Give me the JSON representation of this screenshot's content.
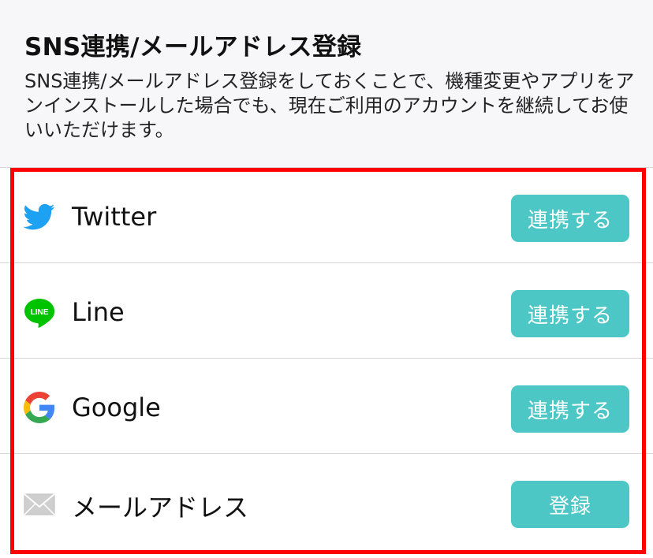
{
  "header": {
    "title": "SNS連携/メールアドレス登録",
    "description": "SNS連携/メールアドレス登録をしておくことで、機種変更やアプリをアンインストールした場合でも、現在ご利用のアカウントを継続してお使いいただけます。"
  },
  "accounts": [
    {
      "label": "Twitter",
      "button": "連携する",
      "icon": "twitter-icon"
    },
    {
      "label": "Line",
      "button": "連携する",
      "icon": "line-icon"
    },
    {
      "label": "Google",
      "button": "連携する",
      "icon": "google-icon"
    },
    {
      "label": "メールアドレス",
      "button": "登録",
      "icon": "mail-icon"
    }
  ],
  "colors": {
    "button": "#4dc6c6",
    "highlight": "#ff0000",
    "twitter": "#1da1f2",
    "line": "#00c300"
  }
}
